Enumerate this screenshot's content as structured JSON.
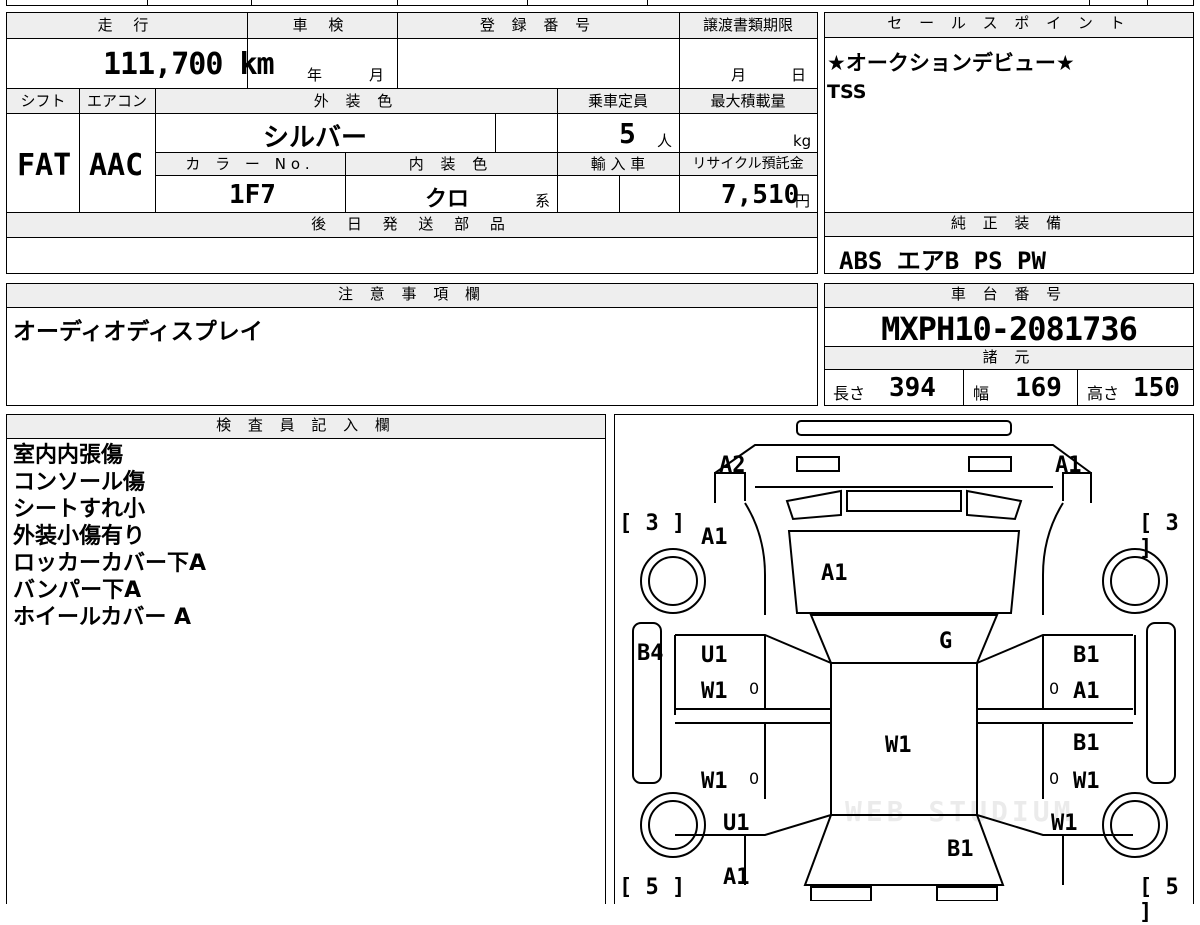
{
  "vehicle": {
    "mileage_label": "走 行",
    "mileage": "111,700 km",
    "inspection_label": "車 検",
    "inspection_year_unit": "年",
    "inspection_month_unit": "月",
    "registration_label": "登 録 番 号",
    "transfer_label": "譲渡書類期限",
    "transfer_month_unit": "月",
    "transfer_day_unit": "日",
    "shift_label": "シフト",
    "shift": "FAT",
    "ac_label": "エアコン",
    "ac": "AAC",
    "exterior_color_label": "外 装 色",
    "exterior_color": "シルバー",
    "capacity_label": "乗車定員",
    "capacity": "5",
    "capacity_unit": "人",
    "max_load_label": "最大積載量",
    "max_load_unit": "kg",
    "color_no_label": "カ ラ ー No.",
    "color_no": "1F7",
    "interior_color_label": "内 装 色",
    "interior_color": "クロ",
    "interior_color_unit": "系",
    "import_label": "輸 入 車",
    "recycle_label": "リサイクル預託金",
    "recycle_fee": "7,510",
    "recycle_unit": "円",
    "later_parts_label": "後 日 発 送 部 品"
  },
  "sales_point": {
    "label": "セ ー ル ス ポ イ ン ト",
    "line1": "★オークションデビュー★",
    "line2": "TSS"
  },
  "equipment": {
    "label": "純 正 装 備",
    "items": "ABS エアB PS PW"
  },
  "notes": {
    "label": "注 意 事 項 欄",
    "text": "オーディオディスプレイ"
  },
  "chassis": {
    "label": "車 台 番 号",
    "number": "MXPH10-2081736",
    "spec_label": "諸 元",
    "length_label": "長さ",
    "length": "394",
    "width_label": "幅",
    "width": "169",
    "height_label": "高さ",
    "height": "150"
  },
  "inspector": {
    "label": "検 査 員 記 入 欄",
    "lines": [
      "室内内張傷",
      "コンソール傷",
      "シートすれ小",
      "外装小傷有り",
      "ロッカーカバー下A",
      "バンパー下A",
      "ホイールカバー A"
    ]
  },
  "diagram": {
    "front_left": "A2",
    "front_right": "A1",
    "tire_front_left": "3",
    "tire_front_right": "3",
    "tire_rear_left": "5",
    "tire_rear_right": "5",
    "hood_left": "A1",
    "hood": "A1",
    "windshield": "G",
    "left_side": "B4",
    "left_front_door_1": "U1",
    "left_front_door_2": "W1",
    "left_front_door_glass": "0",
    "left_rear_door": "W1",
    "left_rear_door_glass": "0",
    "left_rear_fender": "U1",
    "rear_left_bumper": "A1",
    "roof": "W1",
    "trunk": "B1",
    "right_front_door_1": "B1",
    "right_front_door_2": "A1",
    "right_front_door_glass": "0",
    "right_rear_door_1": "B1",
    "right_rear_door_2": "W1",
    "right_rear_door_glass": "0",
    "right_rear_fender": "W1",
    "watermark": "WEB STUDIUM"
  }
}
